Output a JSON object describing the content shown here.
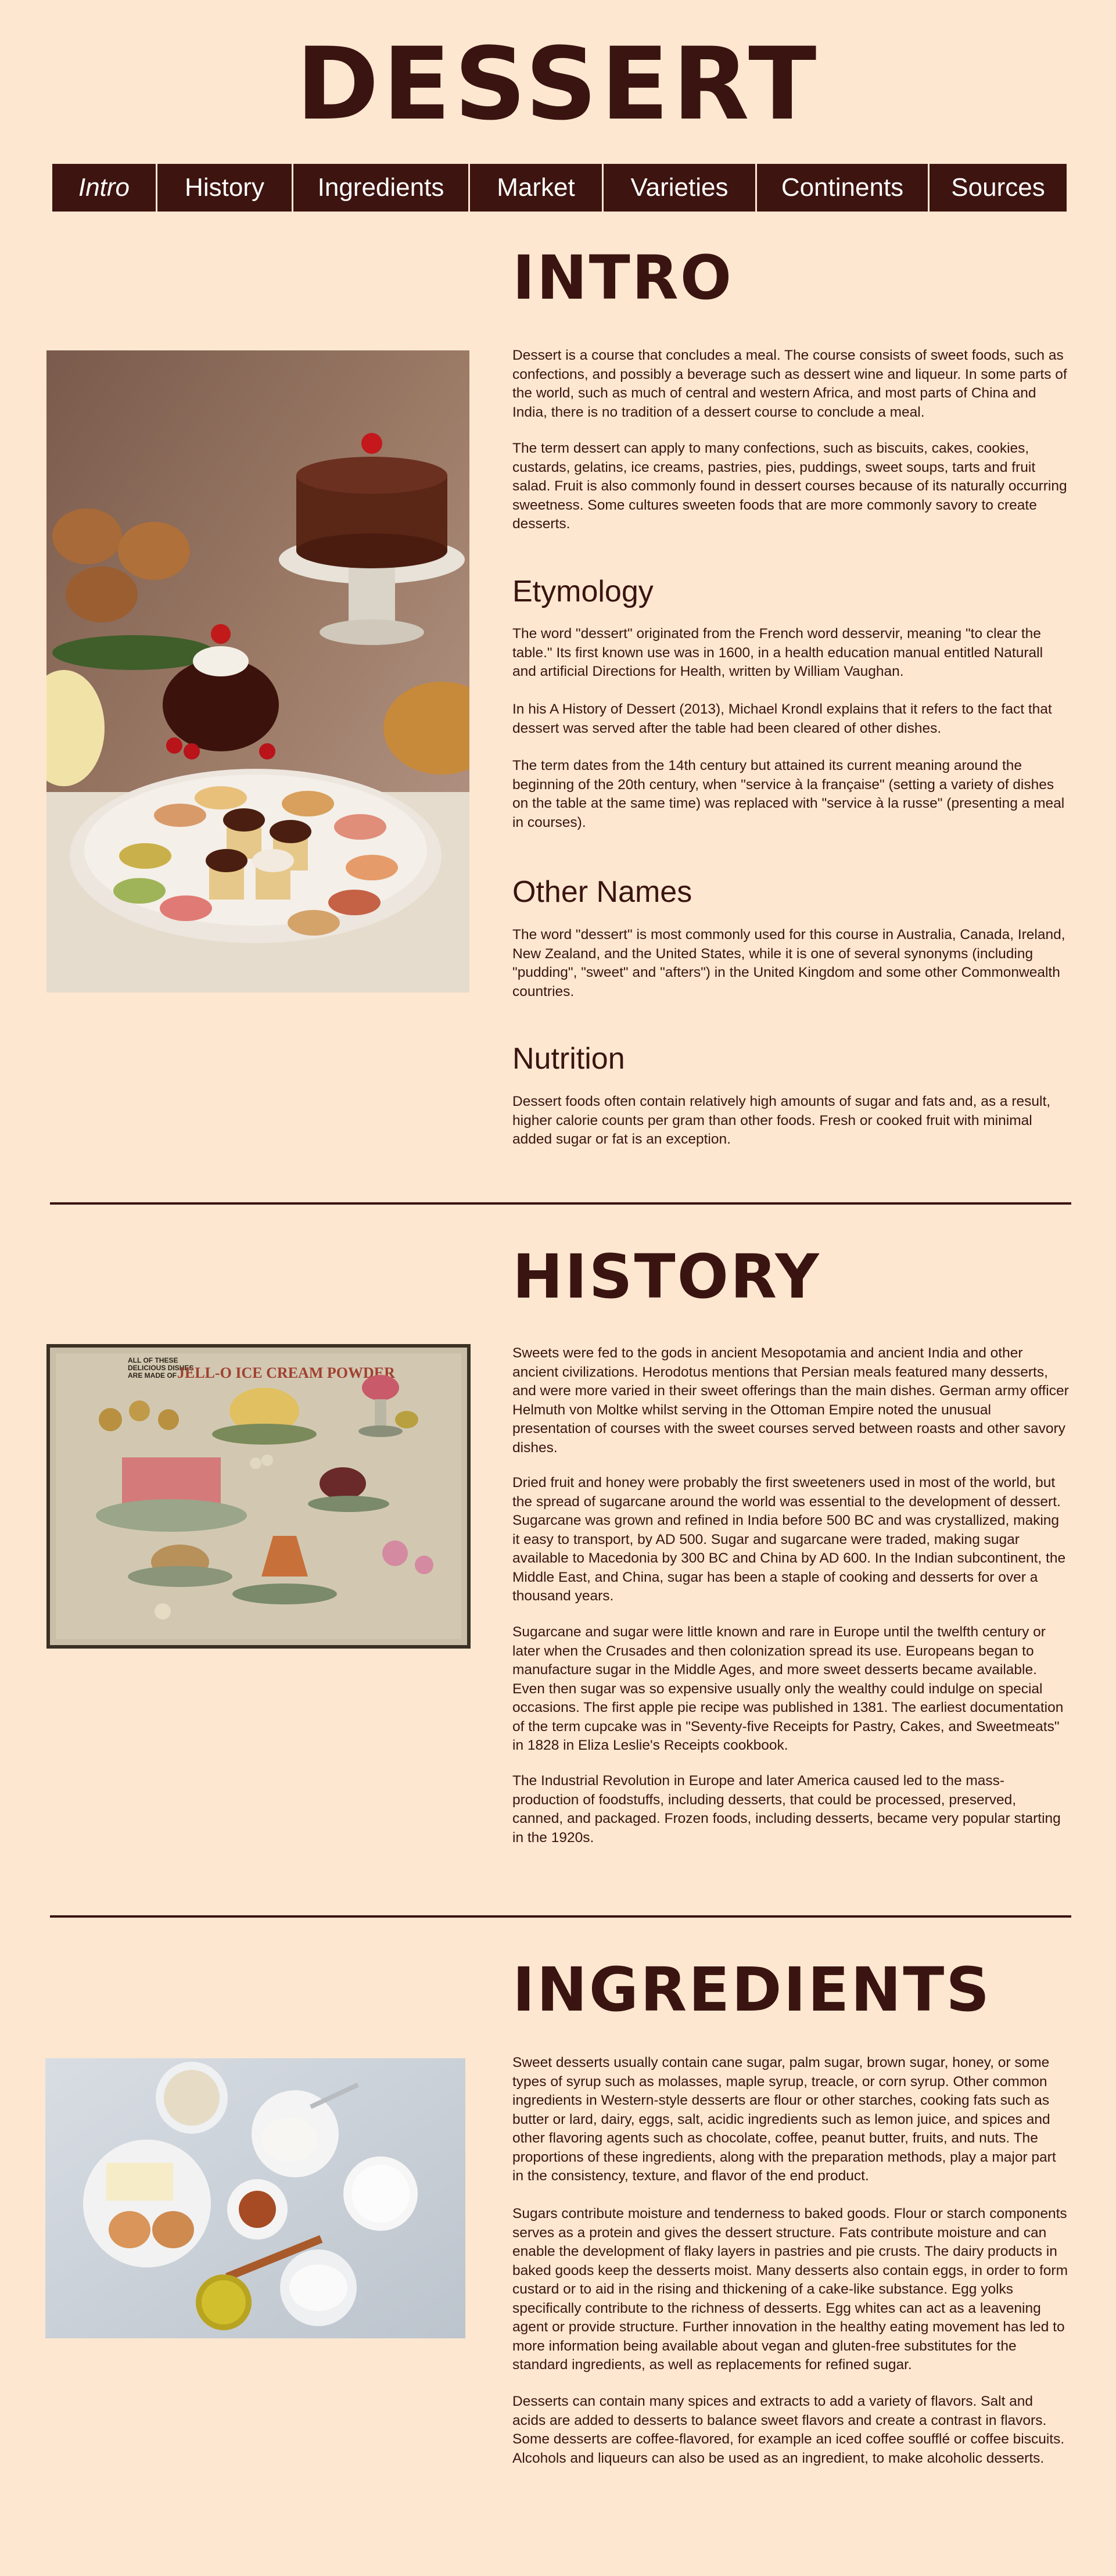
{
  "site": {
    "title": "DESSERT"
  },
  "nav": {
    "items": [
      {
        "label": "Intro"
      },
      {
        "label": "History"
      },
      {
        "label": "Ingredients"
      },
      {
        "label": "Market"
      },
      {
        "label": "Varieties"
      },
      {
        "label": "Continents"
      },
      {
        "label": "Sources"
      }
    ]
  },
  "intro": {
    "title": "INTRO",
    "paragraphs": [
      "Dessert is a course that concludes a meal. The course consists of sweet foods, such as confections, and possibly a beverage such as dessert wine and liqueur. In some parts of the world, such as much of central and western Africa, and most parts of China and India, there is no tradition of a dessert course to conclude a meal.",
      "The term dessert can apply to many confections, such as biscuits, cakes, cookies, custards, gelatins, ice creams, pastries, pies, puddings, sweet soups, tarts and fruit salad. Fruit is also commonly found in dessert courses because of its naturally occurring sweetness. Some cultures sweeten foods that are more commonly savory to create desserts."
    ],
    "etymology": {
      "title": "Etymology",
      "paragraphs": [
        "The word \"dessert\" originated from the French word desservir, meaning \"to clear the table.\" Its first known use was in 1600, in a health education manual entitled Naturall and artificial Directions for Health, written by William Vaughan.",
        "In his A History of Dessert (2013), Michael Krondl explains that it refers to the fact that dessert was served after the table had been cleared of other dishes.",
        "The term dates from the 14th century but attained its current meaning around the beginning of the 20th century, when \"service à la française\" (setting a variety of dishes on the table at the same time) was replaced with \"service à la russe\" (presenting a meal in courses)."
      ]
    },
    "other_names": {
      "title": "Other Names",
      "paragraphs": [
        "The word \"dessert\" is most commonly used for this course in Australia, Canada, Ireland, New Zealand, and the United States, while it is one of several synonyms (including \"pudding\", \"sweet\" and \"afters\") in the United Kingdom and some other Commonwealth countries."
      ]
    },
    "nutrition": {
      "title": "Nutrition",
      "paragraphs": [
        "Dessert foods often contain relatively high amounts of sugar and fats and, as a result, higher calorie counts per gram than other foods. Fresh or cooked fruit with minimal added sugar or fat is an exception."
      ]
    }
  },
  "history": {
    "title": "HISTORY",
    "poster_text": {
      "line1": "ALL OF THESE",
      "line2": "DELICIOUS DISHES",
      "line3": "ARE MADE OF",
      "brand": "JELL-O ICE CREAM POWDER"
    },
    "paragraphs": [
      "Sweets were fed to the gods in ancient Mesopotamia and ancient India and other ancient civilizations. Herodotus mentions that Persian meals featured many desserts, and were more varied in their sweet offerings than the main dishes. German army officer Helmuth von Moltke whilst serving in the Ottoman Empire noted the unusual presentation of courses with the sweet courses served between roasts and other savory dishes.",
      "Dried fruit and honey were probably the first sweeteners used in most of the world, but the spread of sugarcane around the world was essential to the development of dessert. Sugarcane was grown and refined in India before 500 BC and was crystallized, making it easy to transport, by AD 500. Sugar and sugarcane were traded, making sugar available to Macedonia by 300 BC and China by AD 600. In the Indian subcontinent, the Middle East, and China, sugar has been a staple of cooking and desserts for over a thousand years.",
      "Sugarcane and sugar were little known and rare in Europe until the twelfth century or later when the Crusades and then colonization spread its use. Europeans began to manufacture sugar in the Middle Ages, and more sweet desserts became available. Even then sugar was so expensive usually only the wealthy could indulge on special occasions. The first apple pie recipe was published in 1381. The earliest documentation of the term cupcake was in \"Seventy-five Receipts for Pastry, Cakes, and Sweetmeats\" in 1828 in Eliza Leslie's Receipts cookbook.",
      "The Industrial Revolution in Europe and later America caused led to the mass-production of foodstuffs, including desserts, that could be processed, preserved, canned, and packaged. Frozen foods, including desserts, became very popular starting in the 1920s."
    ]
  },
  "ingredients": {
    "title": "INGREDIENTS",
    "paragraphs": [
      "Sweet desserts usually contain cane sugar, palm sugar, brown sugar, honey, or some types of syrup such as molasses, maple syrup, treacle, or corn syrup. Other common ingredients in Western-style desserts are flour or other starches, cooking fats such as butter or lard, dairy, eggs, salt, acidic ingredients such as lemon juice, and spices and other flavoring agents such as chocolate, coffee, peanut butter, fruits, and nuts. The proportions of these ingredients, along with the preparation methods, play a major part in the consistency, texture, and flavor of the end product.",
      "Sugars contribute moisture and tenderness to baked goods. Flour or starch components serves as a protein and gives the dessert structure. Fats contribute moisture and can enable the development of flaky layers in pastries and pie crusts. The dairy products in baked goods keep the desserts moist. Many desserts also contain eggs, in order to form custard or to aid in the rising and thickening of a cake-like substance. Egg yolks specifically contribute to the richness of desserts. Egg whites can act as a leavening agent or provide structure. Further innovation in the healthy eating movement has led to more information being available about vegan and gluten-free substitutes for the standard ingredients, as well as replacements for refined sugar.",
      "Desserts can contain many spices and extracts to add a variety of flavors. Salt and acids are added to desserts to balance sweet flavors and create a contrast in flavors. Some desserts are coffee-flavored, for example an iced coffee soufflé or coffee biscuits. Alcohols and liqueurs can also be used as an ingredient, to make alcoholic desserts."
    ]
  }
}
